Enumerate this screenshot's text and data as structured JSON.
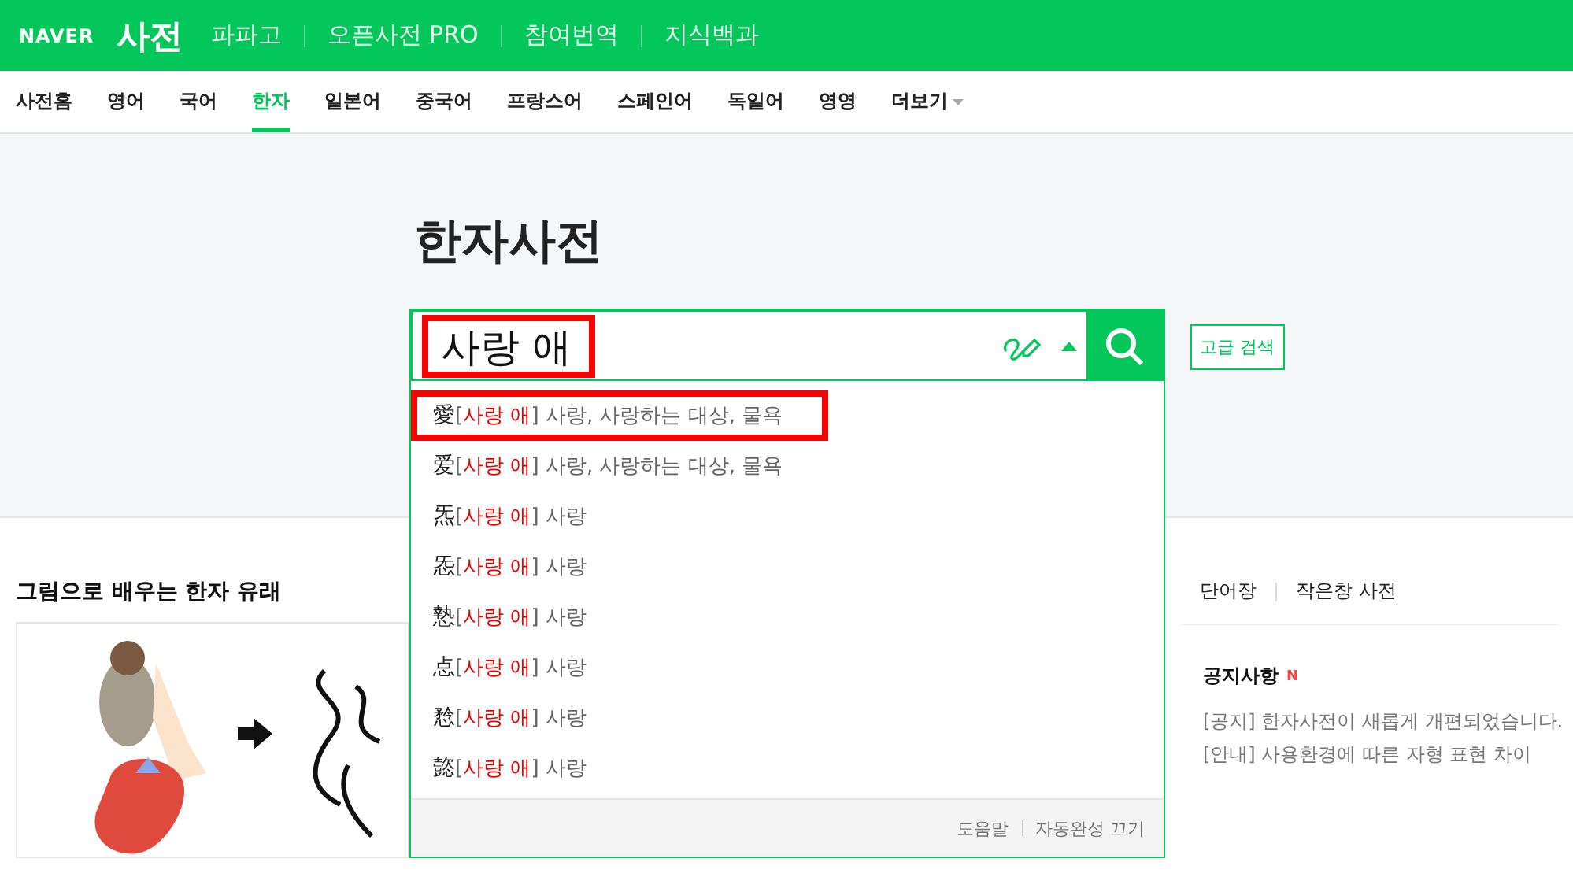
{
  "header": {
    "logo": "NAVER",
    "service": "사전",
    "links": [
      "파파고",
      "오픈사전 PRO",
      "참여번역",
      "지식백과"
    ]
  },
  "nav": {
    "tabs": [
      {
        "label": "사전홈",
        "selected": false
      },
      {
        "label": "영어",
        "selected": false
      },
      {
        "label": "국어",
        "selected": false
      },
      {
        "label": "한자",
        "selected": true
      },
      {
        "label": "일본어",
        "selected": false
      },
      {
        "label": "중국어",
        "selected": false
      },
      {
        "label": "프랑스어",
        "selected": false
      },
      {
        "label": "스페인어",
        "selected": false
      },
      {
        "label": "독일어",
        "selected": false
      },
      {
        "label": "영영",
        "selected": false
      },
      {
        "label": "더보기",
        "selected": false,
        "kind": "more"
      }
    ]
  },
  "title": "한자사전",
  "search": {
    "value": "사랑 애",
    "highlighted": true,
    "advanced": "고급 검색"
  },
  "suggestions": {
    "brackets": [
      "[",
      "]"
    ],
    "items": [
      {
        "hanja": "愛",
        "reading": "사랑 애",
        "meaning": "사랑, 사랑하는 대상, 물욕",
        "highlighted": true
      },
      {
        "hanja": "爱",
        "reading": "사랑 애",
        "meaning": "사랑, 사랑하는 대상, 물욕",
        "highlighted": false
      },
      {
        "hanja": "炁",
        "reading": "사랑 애",
        "meaning": "사랑",
        "highlighted": false
      },
      {
        "hanja": "㤅",
        "reading": "사랑 애",
        "meaning": "사랑",
        "highlighted": false
      },
      {
        "hanja": "慹",
        "reading": "사랑 애",
        "meaning": "사랑",
        "highlighted": false
      },
      {
        "hanja": "㤐",
        "reading": "사랑 애",
        "meaning": "사랑",
        "highlighted": false
      },
      {
        "hanja": "㥤",
        "reading": "사랑 애",
        "meaning": "사랑",
        "highlighted": false
      },
      {
        "hanja": "㦤",
        "reading": "사랑 애",
        "meaning": "사랑",
        "highlighted": false
      }
    ],
    "footer": [
      "도움말",
      "자동완성 끄기"
    ]
  },
  "origin_section": {
    "title": "그림으로 배우는 한자 유래"
  },
  "side": {
    "links": [
      "단어장",
      "작은창 사전"
    ],
    "notice_title": "공지사항",
    "notice_badge": "N",
    "notices": [
      "[공지] 한자사전이 새롭게 개편되었습니다.",
      "[안내] 사용환경에 따른 자형 표현 차이"
    ]
  }
}
